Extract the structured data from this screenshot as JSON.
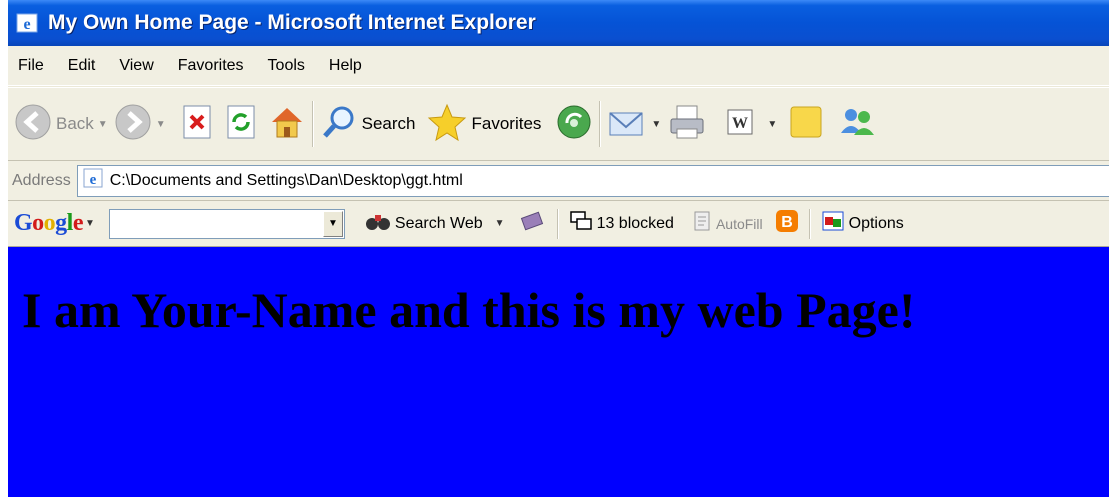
{
  "window": {
    "title": "My Own Home Page - Microsoft Internet Explorer",
    "icon": "ie-icon"
  },
  "menu": {
    "items": [
      "File",
      "Edit",
      "View",
      "Favorites",
      "Tools",
      "Help"
    ]
  },
  "toolbar": {
    "back_label": "Back",
    "search_label": "Search",
    "favorites_label": "Favorites"
  },
  "address": {
    "label": "Address",
    "value": "C:\\Documents and Settings\\Dan\\Desktop\\ggt.html"
  },
  "google_toolbar": {
    "logo": [
      "G",
      "o",
      "o",
      "g",
      "l",
      "e"
    ],
    "search_input_value": "",
    "search_web_label": "Search Web",
    "blocked_label": "13 blocked",
    "autofill_label": "AutoFill",
    "options_label": "Options"
  },
  "content": {
    "heading": "I am Your-Name and this is my web Page!",
    "background_color": "#0000ff"
  }
}
